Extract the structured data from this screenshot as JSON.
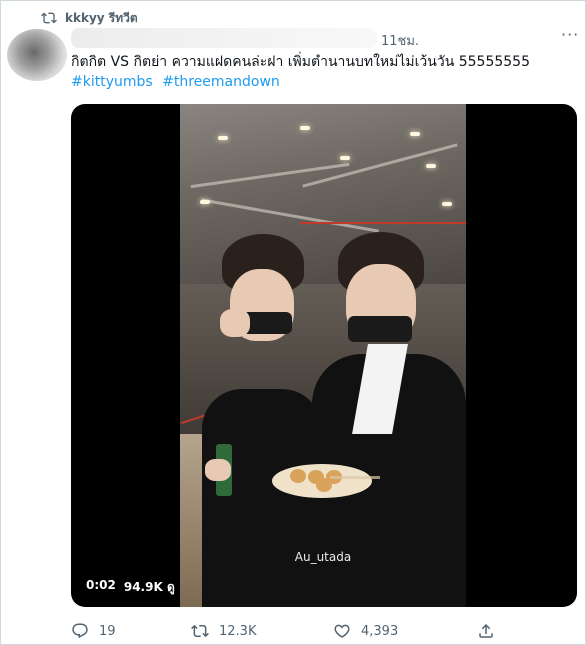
{
  "retweet": {
    "label": "kkkyy รีทวีต",
    "icon": "retweet-icon"
  },
  "tweet": {
    "time": "11ชม.",
    "text": "กิตกิต VS กิตย่า ความแฝดคนล่ะฝา เพิ่มตำนานบทใหม่ไม่เว้นวัน 55555555",
    "hashtags": [
      "#kittyumbs",
      "#threemandown"
    ]
  },
  "video": {
    "watermark": "Au_utada",
    "duration": "0:02",
    "views": "94.9K ดู"
  },
  "actions": {
    "reply_count": "19",
    "retweet_count": "12.3K",
    "like_count": "4,393"
  },
  "colors": {
    "accent": "#1d9bf0",
    "muted": "#536471",
    "text": "#0f1419"
  }
}
